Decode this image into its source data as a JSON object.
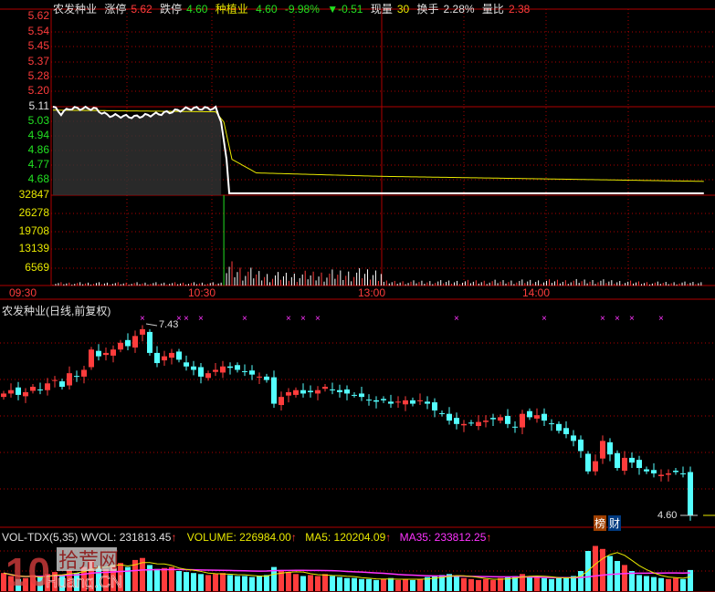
{
  "header": {
    "name": "农发种业",
    "limit_up_label": "涨停",
    "limit_up": "5.62",
    "limit_down_label": "跌停",
    "limit_down": "4.60",
    "sector": "种植业",
    "price": "4.60",
    "pct": "-9.98%",
    "change": "▼-0.51",
    "vol_label": "现量",
    "vol": "30",
    "turnover_label": "换手",
    "turnover": "2.28%",
    "ratio_label": "量比",
    "ratio": "2.38"
  },
  "intraday": {
    "price_ticks": [
      "5.62",
      "5.54",
      "5.45",
      "5.37",
      "5.28",
      "5.20",
      "5.11",
      "5.03",
      "4.94",
      "4.86",
      "4.77",
      "4.68"
    ],
    "volume_ticks": [
      "32847",
      "26278",
      "19708",
      "13139",
      "6569"
    ],
    "time_ticks": [
      "09:30",
      "10:30",
      "13:00",
      "14:00"
    ],
    "price_keyframes": [
      [
        0,
        5.11
      ],
      [
        3,
        5.07
      ],
      [
        6,
        5.1
      ],
      [
        15,
        5.1
      ],
      [
        20,
        5.06
      ],
      [
        30,
        5.05
      ],
      [
        40,
        5.07
      ],
      [
        50,
        5.1
      ],
      [
        60,
        5.1
      ],
      [
        62,
        5.02
      ],
      [
        64,
        4.8
      ],
      [
        65,
        4.6
      ],
      [
        240,
        4.6
      ]
    ],
    "avg_keyframes": [
      [
        0,
        5.09
      ],
      [
        60,
        5.08
      ],
      [
        63,
        5.02
      ],
      [
        66,
        4.8
      ],
      [
        75,
        4.72
      ],
      [
        120,
        4.7
      ],
      [
        240,
        4.67
      ]
    ],
    "volume_keyframes": [
      [
        63,
        32847
      ],
      [
        64,
        9000
      ],
      [
        70,
        6000
      ],
      [
        80,
        4000
      ],
      [
        120,
        5500
      ],
      [
        121,
        7000
      ],
      [
        122,
        1500
      ],
      [
        200,
        2000
      ],
      [
        220,
        1200
      ]
    ]
  },
  "daily": {
    "title": "农发种业(日线,前复权)",
    "high_label": "7.43",
    "last_label": "4.60",
    "closes": [
      6.4,
      6.45,
      6.38,
      6.42,
      6.5,
      6.45,
      6.55,
      6.6,
      6.5,
      6.7,
      6.65,
      6.75,
      7.05,
      6.95,
      7.0,
      7.05,
      7.15,
      7.1,
      7.25,
      7.35,
      7.0,
      6.85,
      6.95,
      7.0,
      6.9,
      6.8,
      6.75,
      6.65,
      6.7,
      6.75,
      6.8,
      6.78,
      6.75,
      6.72,
      6.68,
      6.65,
      6.6,
      6.25,
      6.35,
      6.42,
      6.45,
      6.4,
      6.42,
      6.45,
      6.5,
      6.45,
      6.42,
      6.4,
      6.38,
      6.35,
      6.3,
      6.28,
      6.3,
      6.25,
      6.28,
      6.3,
      6.25,
      6.3,
      6.25,
      6.15,
      6.1,
      6.0,
      5.95,
      5.95,
      5.96,
      5.98,
      6.0,
      6.02,
      6.05,
      5.95,
      5.9,
      6.1,
      6.05,
      6.08,
      6.0,
      5.95,
      5.85,
      5.8,
      5.7,
      5.55,
      5.25,
      5.4,
      5.7,
      5.5,
      5.3,
      5.45,
      5.38,
      5.3,
      5.25,
      5.22,
      5.2,
      5.22,
      5.24,
      5.22,
      4.6
    ],
    "markers": [
      19,
      24,
      25,
      27,
      33,
      39,
      41,
      43,
      62,
      74,
      82,
      84,
      86,
      90
    ],
    "badges": [
      "榜",
      "财"
    ]
  },
  "volume": {
    "label": "VOL-TDX(5,35)",
    "wvol": "WVOL: 231813.45",
    "volume": "VOLUME: 226984.00",
    "ma5": "MA5: 120204.09",
    "ma35": "MA35: 233812.25",
    "values": [
      180,
      150,
      120,
      130,
      160,
      140,
      170,
      190,
      150,
      210,
      180,
      240,
      300,
      250,
      220,
      260,
      280,
      240,
      310,
      330,
      260,
      220,
      230,
      240,
      200,
      190,
      180,
      170,
      160,
      170,
      180,
      160,
      150,
      150,
      140,
      150,
      160,
      240,
      200,
      190,
      170,
      150,
      160,
      150,
      170,
      150,
      140,
      130,
      130,
      120,
      120,
      110,
      120,
      130,
      110,
      120,
      110,
      120,
      140,
      150,
      160,
      170,
      150,
      130,
      120,
      110,
      120,
      110,
      130,
      140,
      150,
      170,
      150,
      140,
      130,
      120,
      130,
      140,
      150,
      200,
      400,
      450,
      420,
      350,
      300,
      260,
      200,
      160,
      150,
      140,
      130,
      120,
      130,
      120,
      210
    ],
    "max": 500
  },
  "watermark": "10 拾荒网 Huang.CN",
  "colors": {
    "up": "#ff3c3c",
    "down": "#54ffff",
    "grid": "#b00000",
    "price": "#ffffff",
    "avg": "#e8e800",
    "ma35": "#ff33ff"
  }
}
